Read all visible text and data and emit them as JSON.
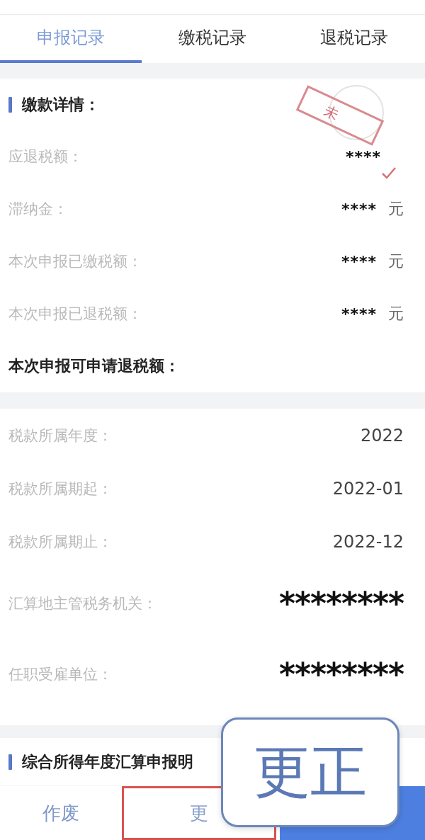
{
  "tabs": [
    {
      "label": "申报记录",
      "selected": true
    },
    {
      "label": "缴税记录",
      "selected": false
    },
    {
      "label": "退税记录",
      "selected": false
    }
  ],
  "payment_details": {
    "title": "缴款详情：",
    "stamp": {
      "text": "未"
    },
    "rows": [
      {
        "label": "应退税额：",
        "value": "****"
      },
      {
        "label": "滞纳金：",
        "value": "****",
        "unit": "元"
      },
      {
        "label": "本次申报已缴税额：",
        "value": "****",
        "unit": "元"
      },
      {
        "label": "本次申报已退税额：",
        "value": "****",
        "unit": "元"
      }
    ],
    "total_label": "本次申报可申请退税额："
  },
  "period_info": {
    "rows": [
      {
        "kind": "text",
        "label": "税款所属年度：",
        "value": "2022"
      },
      {
        "kind": "text",
        "label": "税款所属期起：",
        "value": "2022-01"
      },
      {
        "kind": "text",
        "label": "税款所属期止：",
        "value": "2022-12"
      },
      {
        "kind": "masked",
        "label": "汇算地主管税务机关：",
        "value": "********"
      },
      {
        "kind": "masked",
        "label": "任职受雇单位：",
        "value": "********"
      }
    ]
  },
  "annual_summary": {
    "title": "综合所得年度汇算申报明"
  },
  "bottom_bar": {
    "buttons": [
      {
        "kind": "text",
        "label": "作废",
        "highlighted": false
      },
      {
        "kind": "outline",
        "label": "更",
        "highlighted": true
      },
      {
        "kind": "primary",
        "highlighted": false
      }
    ]
  },
  "callout": {
    "text": "更正"
  }
}
